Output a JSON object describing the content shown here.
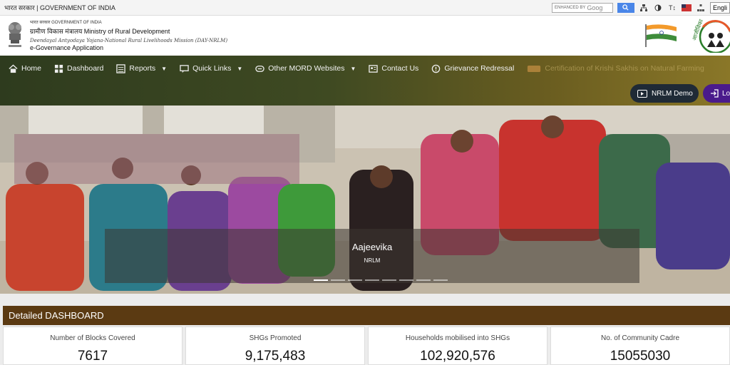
{
  "gov_strip": {
    "text": "भारत सरकार | GOVERNMENT OF INDIA",
    "search_placeholder": "ENHANCED BY",
    "search_brand": "Goog",
    "language": "Engli",
    "text_size_label": "T↕"
  },
  "header": {
    "brand_line1": "भारत सरकार   GOVERNMENT OF INDIA",
    "brand_line2": "ग्रामीण विकास मंत्रालय  Ministry of Rural Development",
    "brand_line3": "Deendayal Antyodaya Yojana-National Rural Livelihoods Mission (DAY-NRLM)",
    "brand_line4": "e-Governance Application",
    "logo_text": "आजीविका"
  },
  "nav": {
    "items": [
      {
        "label": "Home",
        "icon": "home-icon"
      },
      {
        "label": "Dashboard",
        "icon": "dashboard-icon"
      },
      {
        "label": "Reports",
        "icon": "reports-icon",
        "dropdown": true
      },
      {
        "label": "Quick Links",
        "icon": "quick-links-icon",
        "dropdown": true
      },
      {
        "label": "Other MORD Websites",
        "icon": "websites-icon",
        "dropdown": true
      },
      {
        "label": "Contact Us",
        "icon": "contact-icon"
      },
      {
        "label": "Grievance Redressal",
        "icon": "grievance-icon"
      },
      {
        "label": "Certification of Krishi Sakhis on Natural Farming",
        "icon": "certificate-icon"
      }
    ],
    "nrlm_demo": "NRLM Demo",
    "login": "Lo"
  },
  "hero": {
    "caption_title": "Aajeevika",
    "caption_sub": "NRLM",
    "slide_count": 8,
    "active_slide": 1
  },
  "dashboard": {
    "title": "Detailed DASHBOARD",
    "cards": [
      {
        "label": "Number of Blocks Covered",
        "value": "7617"
      },
      {
        "label": "SHGs Promoted",
        "value": "9,175,483"
      },
      {
        "label": "Households mobilised into SHGs",
        "value": "102,920,576"
      },
      {
        "label": "No. of Community Cadre",
        "value": "15055030"
      }
    ]
  },
  "colors": {
    "nav_start": "#2e3b1e",
    "nav_end": "#8a7728",
    "dashboard_bar": "#5b3a12",
    "login": "#4a1b8c",
    "demo": "#1f2a36"
  }
}
